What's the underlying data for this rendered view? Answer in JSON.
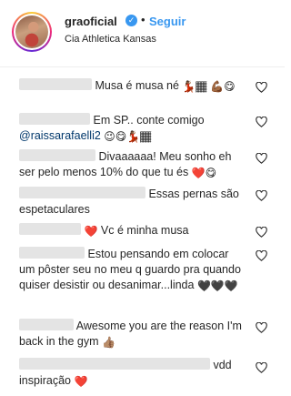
{
  "post": {
    "username": "graoficial",
    "follow_label": "Seguir",
    "separator": "•",
    "location": "Cia Athletica Kansas"
  },
  "comments": [
    {
      "text": "Musa é musa né",
      "emojis": "💃🏾🏾 💪🏾😋"
    },
    {
      "text": "Em SP.. conte comigo",
      "mention": "@raissarafaelli2",
      "emojis": "😉😋💃🏾🏾"
    },
    {
      "text": "Divaaaaaa! Meu sonho eh ser pelo menos 10% do que tu és",
      "emojis": "❤️😋"
    },
    {
      "text": "Essas pernas são espetaculares"
    },
    {
      "text": "Vc é minha musa",
      "emojis_before": "❤️"
    },
    {
      "text": "Estou pensando em colocar um pôster seu no meu q guardo pra quando quiser desistir ou desanimar...linda",
      "emojis": "🖤🖤🖤"
    },
    {
      "text": "Awesome you are the reason I'm back in the gym",
      "emojis": "👍🏽"
    },
    {
      "text": "vdd inspiração",
      "emojis": "❤️"
    }
  ],
  "icons": {
    "verified": "verified-badge-icon",
    "like": "heart-outline-icon"
  },
  "colors": {
    "link_blue": "#3897f0",
    "text": "#262626",
    "mention": "#00376b",
    "heart_red": "#ed4956"
  }
}
